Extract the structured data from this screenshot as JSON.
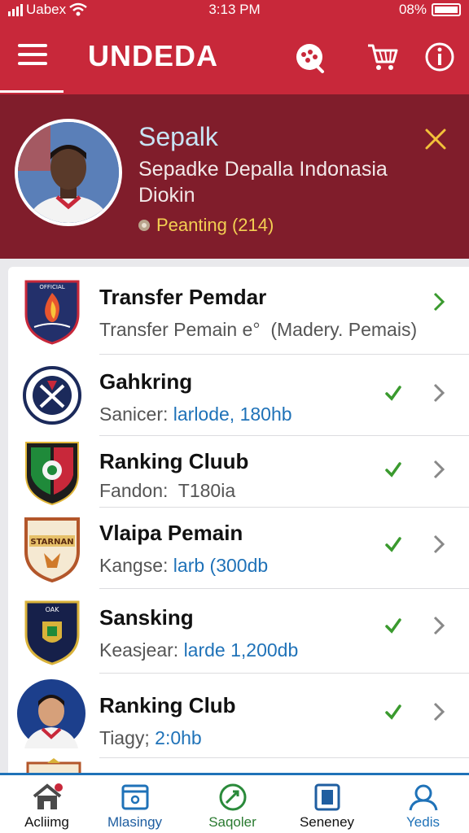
{
  "status_bar": {
    "carrier": "Uabex",
    "time": "3:13 PM",
    "battery": "08%"
  },
  "app": {
    "title": "UNDEDA"
  },
  "header_icons": [
    "menu-icon",
    "chat-icon",
    "cart-icon",
    "info-icon"
  ],
  "profile": {
    "name": "Sepalk",
    "subtitle_line1": "Sepadke Depalla Indonasia",
    "subtitle_line2": "Diokin",
    "status": "Peanting (214)"
  },
  "list": [
    {
      "title": "Transfer Pemdar",
      "sub_label": "Transfer Pemain e°",
      "sub_value": "(Madery. Pemais)",
      "checked": false,
      "badge": "club-crest-icon"
    },
    {
      "title": "Gahkring",
      "sub_label": "Sanicer:",
      "sub_value": "larlode, 180hb",
      "checked": true,
      "badge": "club-crest-icon"
    },
    {
      "title": "Ranking Cluub",
      "sub_label": "Fandon:",
      "sub_value": "T180ia",
      "checked": true,
      "badge": "club-crest-icon"
    },
    {
      "title": "Vlaipa Pemain",
      "sub_label": "Kangse:",
      "sub_value": "larb (300db",
      "checked": true,
      "badge": "club-crest-icon"
    },
    {
      "title": "Sansking",
      "sub_label": "Keasjear:",
      "sub_value": "larde 1,200db",
      "checked": true,
      "badge": "club-crest-icon"
    },
    {
      "title": "Ranking Club",
      "sub_label": "Tiagy;",
      "sub_value": "2:0hb",
      "checked": true,
      "badge": "player-avatar"
    }
  ],
  "bottom_nav": [
    {
      "label": "Acliimg",
      "icon": "home-icon"
    },
    {
      "label": "Mlasingy",
      "icon": "wallet-icon"
    },
    {
      "label": "Saqoler",
      "icon": "whistle-icon"
    },
    {
      "label": "Seneney",
      "icon": "device-icon"
    },
    {
      "label": "Yedis",
      "icon": "user-icon"
    }
  ],
  "colors": {
    "primary": "#c8283a",
    "banner": "#801d2b",
    "accent_blue": "#1f72b8",
    "check_green": "#3a9a2e",
    "status_yellow": "#f3cf52"
  }
}
